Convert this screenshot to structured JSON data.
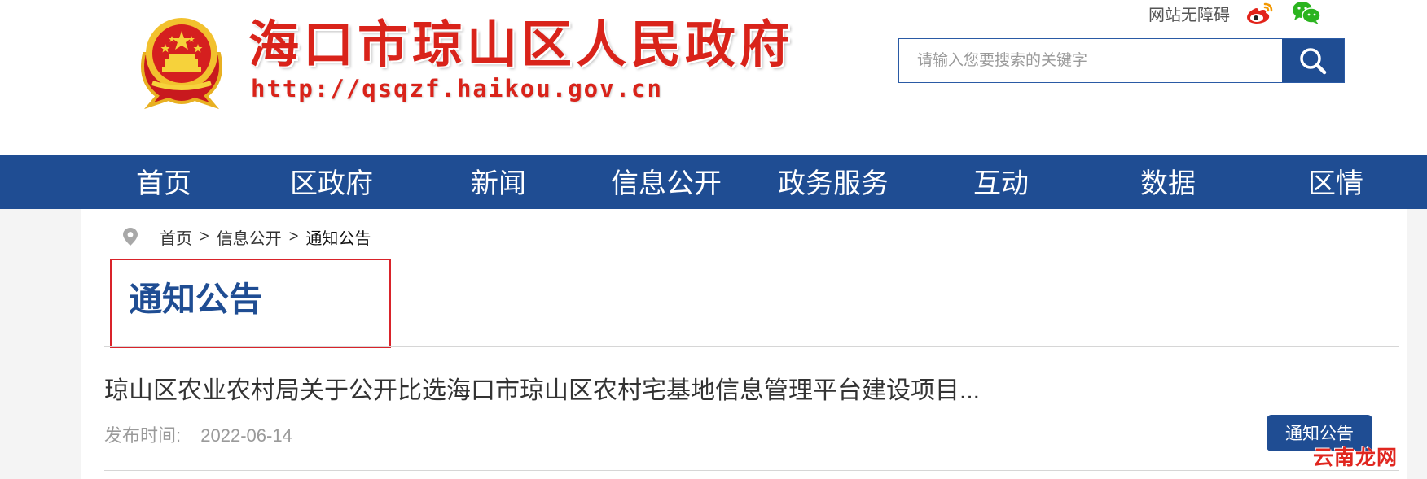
{
  "header": {
    "site_title": "海口市琼山区人民政府",
    "site_url": "http://qsqzf.haikou.gov.cn",
    "accessibility_link": "网站无障碍",
    "social_icons": [
      "weibo-icon",
      "wechat-icon"
    ],
    "search": {
      "placeholder": "请输入您要搜索的关键字",
      "value": ""
    }
  },
  "nav": {
    "items": [
      "首页",
      "区政府",
      "新闻",
      "信息公开",
      "政务服务",
      "互动",
      "数据",
      "区情"
    ]
  },
  "breadcrumb": {
    "items": [
      "首页",
      "信息公开",
      "通知公告"
    ],
    "separator": ">"
  },
  "section": {
    "title": "通知公告"
  },
  "articles": [
    {
      "title": "琼山区农业农村局关于公开比选海口市琼山区农村宅基地信息管理平台建设项目...",
      "date_label": "发布时间:",
      "date": "2022-06-14",
      "category": "通知公告"
    }
  ],
  "watermark": {
    "first": "云南",
    "rest": "龙网"
  },
  "colors": {
    "brand_blue": "#1f4d93",
    "title_red": "#d9231a",
    "highlight_box_red": "#d9232a"
  }
}
